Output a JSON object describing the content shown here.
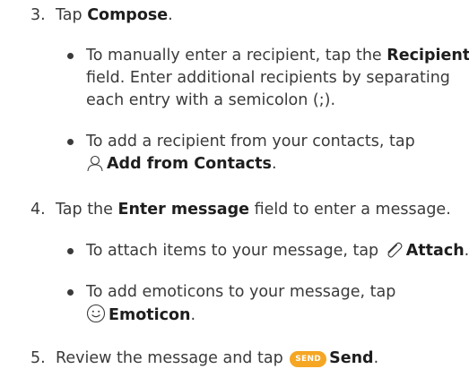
{
  "steps": [
    {
      "number": "3.",
      "text_before": "Tap ",
      "bold": "Compose",
      "text_after": ".",
      "bullets": [
        {
          "lines": [
            {
              "text_before": "To manually enter a recipient, tap the ",
              "bold": "Recipient"
            },
            {
              "text": "field. Enter additional recipients by separating"
            },
            {
              "text": "each entry with a semicolon (;)."
            }
          ]
        },
        {
          "lines": [
            {
              "text": "To add a recipient from your contacts, tap"
            },
            {
              "icon": "contact-person-icon",
              "bold": "Add from Contacts",
              "text_after": "."
            }
          ]
        }
      ]
    },
    {
      "number": "4.",
      "text_before": "Tap the ",
      "bold": "Enter message",
      "text_after": " field to enter a message.",
      "bullets": [
        {
          "lines": [
            {
              "text_before": "To attach items to your message, tap ",
              "icon": "paperclip-icon",
              "bold": "Attach",
              "text_after": "."
            }
          ]
        },
        {
          "lines": [
            {
              "text": "To add emoticons to your message, tap"
            },
            {
              "icon": "smiley-icon",
              "bold": "Emoticon",
              "text_after": "."
            }
          ]
        }
      ]
    },
    {
      "number": "5.",
      "text_before": "Review the message and tap ",
      "badge": "SEND",
      "bold": "Send",
      "text_after": "."
    }
  ],
  "colors": {
    "text": "#3a3a3a",
    "bold_text": "#1e1e1e",
    "send_badge": "#f5a623"
  }
}
